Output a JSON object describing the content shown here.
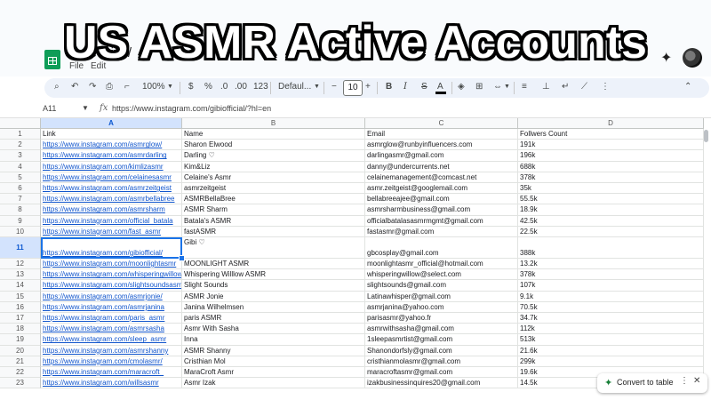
{
  "overlay_title": "US ASMR Active Accounts",
  "header": {
    "doc_title": "Free Give/",
    "menu": [
      "File",
      "Edit"
    ]
  },
  "toolbar": {
    "zoom": "100%",
    "currency": "$",
    "percent": "%",
    "dec_decrease": ".0",
    "dec_increase": ".00",
    "number_format": "123",
    "font": "Defaul...",
    "minus": "−",
    "font_size": "10",
    "plus": "+",
    "bold": "B",
    "italic": "I",
    "strike": "S",
    "text_color": "A"
  },
  "formula_bar": {
    "name_box": "A11",
    "fx": "fx",
    "formula": "https://www.instagram.com/gibiofficial/?hl=en"
  },
  "columns": [
    "A",
    "B",
    "C",
    "D"
  ],
  "selected_cell": "A11",
  "headers": [
    "Link",
    "Name",
    "Email",
    "Follwers Count"
  ],
  "rows": [
    {
      "n": "2",
      "link": "https://www.instagram.com/asmrglow/",
      "name": "Sharon Elwood",
      "email": "asmrglow@runbyinfluencers.com",
      "followers": "191k"
    },
    {
      "n": "3",
      "link": "https://www.instagram.com/asmrdarling",
      "name": "Darling ♡",
      "email": "darlingasmr@gmail.com",
      "followers": "196k"
    },
    {
      "n": "4",
      "link": "https://www.instagram.com/kimlizasmr",
      "name": "Kim&Liz",
      "email": "danny@undercurrents.net",
      "followers": "688k"
    },
    {
      "n": "5",
      "link": "https://www.instagram.com/celainesasmr",
      "name": "Celaine's Asmr",
      "email": "celainemanagement@comcast.net",
      "followers": "378k"
    },
    {
      "n": "6",
      "link": "https://www.instagram.com/asmrzeitgeist",
      "name": "asmrzeitgeist",
      "email": "asmr.zeitgeist@googlemail.com",
      "followers": "35k"
    },
    {
      "n": "7",
      "link": "https://www.instagram.com/asmrbellabree",
      "name": "ASMRBellaBree",
      "email": "bellabreeajee@gmail.com",
      "followers": "55.5k"
    },
    {
      "n": "8",
      "link": "https://www.instagram.com/asmrsharm",
      "name": "ASMR Sharm",
      "email": "asmrsharmbusiness@gmail.com",
      "followers": "18.9k"
    },
    {
      "n": "9",
      "link": "https://www.instagram.com/official_batala",
      "name": "Batala's ASMR",
      "email": "officialbatalasasmrmgmt@gmail.com",
      "followers": "42.5k"
    },
    {
      "n": "10",
      "link": "https://www.instagram.com/fast_asmr",
      "name": "fastASMR",
      "email": "fastasmr@gmail.com",
      "followers": "22.5k"
    },
    {
      "n": "11",
      "link": "https://www.instagram.com/gibiofficial/",
      "name": "Gibi ♡",
      "email": "gbcosplay@gmail.com",
      "followers": "388k"
    },
    {
      "n": "12",
      "link": "https://www.instagram.com/moonlightasmr",
      "name": "MOONLIGHT ASMR",
      "email": "moonlightasmr_official@hotmail.com",
      "followers": "13.2k"
    },
    {
      "n": "13",
      "link": "https://www.instagram.com/whisperingwillow",
      "name": "Whispering Willlow ASMR",
      "email": "whisperingwillow@select.com",
      "followers": "378k"
    },
    {
      "n": "14",
      "link": "https://www.instagram.com/slightsoundsasmr",
      "name": "Slight Sounds",
      "email": "slightsounds@gmail.com",
      "followers": "107k"
    },
    {
      "n": "15",
      "link": "https://www.instagram.com/asmrjonie/",
      "name": "ASMR Jonie",
      "email": "Latinawhisper@gmail.com",
      "followers": "9.1k"
    },
    {
      "n": "16",
      "link": "https://www.instagram.com/asmrjanina",
      "name": "Janina Wilhelmsen",
      "email": "asmrjanina@yahoo.com",
      "followers": "70.5k"
    },
    {
      "n": "17",
      "link": "https://www.instagram.com/paris_asmr",
      "name": "paris ASMR",
      "email": "parisasmr@yahoo.fr",
      "followers": "34.7k"
    },
    {
      "n": "18",
      "link": "https://www.instagram.com/asmrsasha",
      "name": "Asmr With Sasha",
      "email": "asmrwithsasha@gmail.com",
      "followers": "112k"
    },
    {
      "n": "19",
      "link": "https://www.instagram.com/sleep_asmr",
      "name": "Inna",
      "email": "1sleepasmrtist@gmail.com",
      "followers": "513k"
    },
    {
      "n": "20",
      "link": "https://www.instagram.com/asmrshanny",
      "name": "ASMR Shanny",
      "email": "Shanondorfsly@gmail.com",
      "followers": "21.6k"
    },
    {
      "n": "21",
      "link": "https://www.instagram.com/cmolasmr/",
      "name": "Cristhian Mol",
      "email": "cristhianmolasmr@gmail.com",
      "followers": "299k"
    },
    {
      "n": "22",
      "link": "https://www.instagram.com/maracroft_",
      "name": "MaraCroft Asmr",
      "email": "maracroftasmr@gmail.com",
      "followers": "19.6k"
    },
    {
      "n": "23",
      "link": "https://www.instagram.com/willsasmr",
      "name": "Asmr Izak",
      "email": "izakbusinessinquires20@gmail.com",
      "followers": "14.5k"
    }
  ],
  "convert_chip": {
    "label": "Convert to table"
  },
  "icons": {
    "search": "search-icon",
    "undo": "undo-icon",
    "redo": "redo-icon",
    "print": "print-icon",
    "paint_format": "paint-format-icon",
    "gemini": "sparkle-icon",
    "convert": "table-icon"
  },
  "colors": {
    "link": "#1155cc",
    "selection": "#1a73e8",
    "sheets_green": "#0f9d58"
  }
}
